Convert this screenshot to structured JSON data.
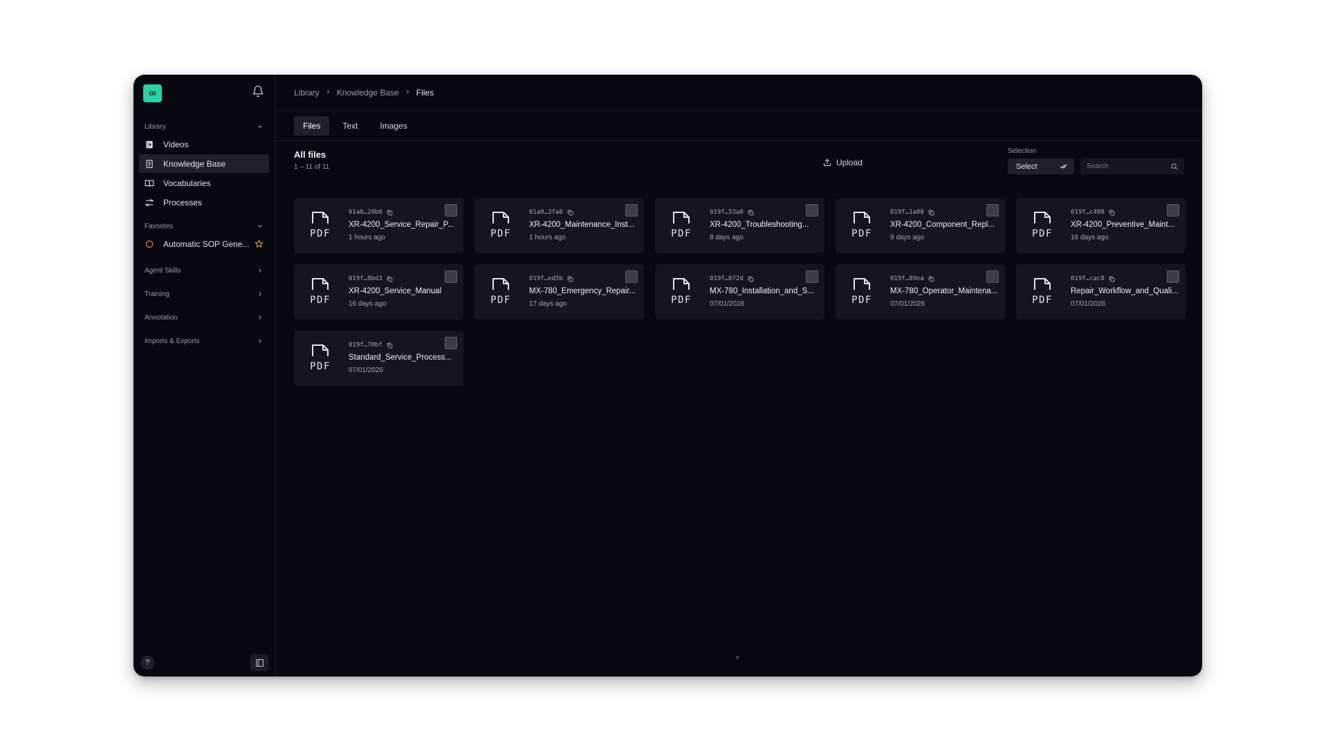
{
  "sidebar": {
    "logo_text": "ɑı",
    "library_label": "Library",
    "nav_items": [
      {
        "label": "Videos",
        "icon": "video-icon"
      },
      {
        "label": "Knowledge Base",
        "icon": "document-icon",
        "active": true
      },
      {
        "label": "Vocabularies",
        "icon": "book-icon"
      },
      {
        "label": "Processes",
        "icon": "process-icon"
      }
    ],
    "favorites_label": "Favorites",
    "favorites": [
      {
        "label": "Automatic SOP Gene...",
        "icon": "circle-icon",
        "starred": true
      }
    ],
    "groups": [
      {
        "label": "Agent Skills"
      },
      {
        "label": "Training"
      },
      {
        "label": "Annotation"
      },
      {
        "label": "Imports & Exports"
      }
    ],
    "help_label": "?"
  },
  "breadcrumb": [
    "Library",
    "Knowledge Base",
    "Files"
  ],
  "tabs": [
    {
      "label": "Files",
      "active": true
    },
    {
      "label": "Text"
    },
    {
      "label": "Images"
    }
  ],
  "header": {
    "title": "All files",
    "count": "1 – 11 of 11",
    "upload_label": "Upload",
    "selection_label": "Selection",
    "select_value": "Select",
    "search_placeholder": "Search"
  },
  "files": [
    {
      "id": "01a0…20b8",
      "name": "XR-4200_Service_Repair_P...",
      "date": "1 hours ago"
    },
    {
      "id": "01a0…3fa8",
      "name": "XR-4200_Maintenance_Inst...",
      "date": "1 hours ago"
    },
    {
      "id": "019f…53a8",
      "name": "XR-4200_Troubleshooting...",
      "date": "8 days ago"
    },
    {
      "id": "019f…1a88",
      "name": "XR-4200_Component_Repl...",
      "date": "9 days ago"
    },
    {
      "id": "019f…c480",
      "name": "XR-4200_Preventive_Maint...",
      "date": "16 days ago"
    },
    {
      "id": "019f…8bd3",
      "name": "XR-4200_Service_Manual",
      "date": "16 days ago"
    },
    {
      "id": "019f…ed5b",
      "name": "MX-780_Emergency_Repair...",
      "date": "17 days ago"
    },
    {
      "id": "019f…072d",
      "name": "MX-780_Installation_and_S...",
      "date": "07/01/2026"
    },
    {
      "id": "019f…89ea",
      "name": "MX-780_Operator_Maintena...",
      "date": "07/01/2026"
    },
    {
      "id": "019f…cac8",
      "name": "Repair_Workflow_and_Quali...",
      "date": "07/01/2026"
    },
    {
      "id": "019f…70bf",
      "name": "Standard_Service_Process...",
      "date": "07/01/2026"
    }
  ],
  "pdf_label": "PDF",
  "colors": {
    "brand": "#27d3a3",
    "background": "#070812",
    "card": "#141520",
    "star": "#f0a53a",
    "favorite_circle": "#e0793a"
  }
}
